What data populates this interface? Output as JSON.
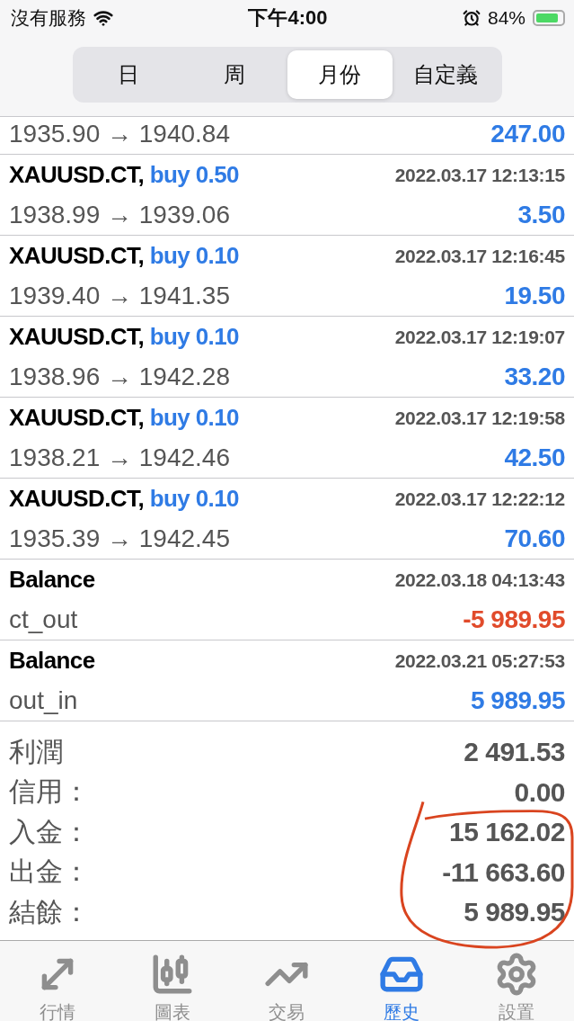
{
  "status_bar": {
    "carrier": "沒有服務",
    "time": "下午4:00",
    "battery": "84%"
  },
  "segments": [
    {
      "label": "日",
      "selected": false
    },
    {
      "label": "周",
      "selected": false
    },
    {
      "label": "月份",
      "selected": true
    },
    {
      "label": "自定義",
      "selected": false
    }
  ],
  "deals": [
    {
      "prices": "1935.90 → 1940.84",
      "profit": "247.00",
      "color": "#2f7be5"
    },
    {
      "symbol": "XAUUSD.CT,",
      "side": "buy 0.50",
      "time": "2022.03.17 12:13:15",
      "prices": "1938.99 → 1939.06",
      "profit": "3.50",
      "color": "#2f7be5"
    },
    {
      "symbol": "XAUUSD.CT,",
      "side": "buy 0.10",
      "time": "2022.03.17 12:16:45",
      "prices": "1939.40 → 1941.35",
      "profit": "19.50",
      "color": "#2f7be5"
    },
    {
      "symbol": "XAUUSD.CT,",
      "side": "buy 0.10",
      "time": "2022.03.17 12:19:07",
      "prices": "1938.96 → 1942.28",
      "profit": "33.20",
      "color": "#2f7be5"
    },
    {
      "symbol": "XAUUSD.CT,",
      "side": "buy 0.10",
      "time": "2022.03.17 12:19:58",
      "prices": "1938.21 → 1942.46",
      "profit": "42.50",
      "color": "#2f7be5"
    },
    {
      "symbol": "XAUUSD.CT,",
      "side": "buy 0.10",
      "time": "2022.03.17 12:22:12",
      "prices": "1935.39 → 1942.45",
      "profit": "70.60",
      "color": "#2f7be5"
    },
    {
      "symbol": "Balance",
      "time": "2022.03.18 04:13:43",
      "prices": "ct_out",
      "profit": "-5 989.95",
      "color": "#e14b2b"
    },
    {
      "symbol": "Balance",
      "time": "2022.03.21 05:27:53",
      "prices": "out_in",
      "profit": "5 989.95",
      "color": "#2f7be5"
    }
  ],
  "summary": [
    {
      "label": "利潤",
      "value": "2 491.53"
    },
    {
      "label": "信用：",
      "value": "0.00"
    },
    {
      "label": "入金：",
      "value": "15 162.02"
    },
    {
      "label": "出金：",
      "value": "-11 663.60"
    },
    {
      "label": "結餘：",
      "value": "5 989.95"
    }
  ],
  "annotations": [
    {
      "kind": "ellipse",
      "color": "#d9441f"
    }
  ],
  "tab_bar": [
    {
      "label": "行情",
      "kind": "arrows",
      "selected": false
    },
    {
      "label": "圖表",
      "kind": "candles",
      "selected": false
    },
    {
      "label": "交易",
      "kind": "trend",
      "selected": false
    },
    {
      "label": "歷史",
      "kind": "inbox",
      "selected": true
    },
    {
      "label": "設置",
      "kind": "gear",
      "selected": false
    }
  ]
}
